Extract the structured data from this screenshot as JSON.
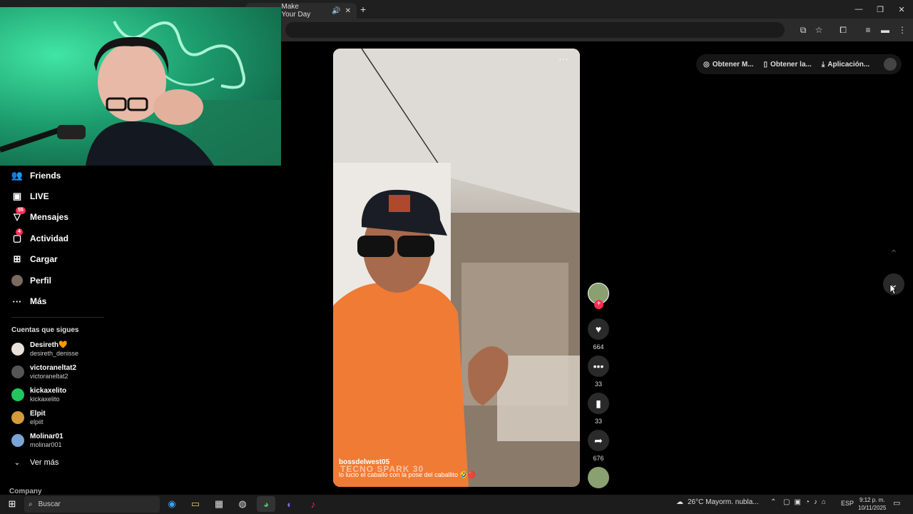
{
  "browser": {
    "active_tab_title": "Make Your Day",
    "new_tab_label": "+",
    "window_buttons": {
      "minimize": "—",
      "maximize": "❐",
      "close": "✕"
    }
  },
  "sidebar": {
    "items": [
      {
        "label": "Friends",
        "icon": "friends-icon",
        "glyph": "👥"
      },
      {
        "label": "LIVE",
        "icon": "live-icon",
        "glyph": "📺"
      },
      {
        "label": "Mensajes",
        "icon": "messages-icon",
        "glyph": "✈",
        "badge": "55"
      },
      {
        "label": "Actividad",
        "icon": "activity-icon",
        "glyph": "💬",
        "badge": "4"
      },
      {
        "label": "Cargar",
        "icon": "upload-icon",
        "glyph": "⊞"
      },
      {
        "label": "Perfil",
        "icon": "profile-avatar",
        "glyph": "●"
      },
      {
        "label": "Más",
        "icon": "more-icon",
        "glyph": "···"
      }
    ],
    "following_header": "Cuentas que sigues",
    "following": [
      {
        "name": "Desireth🧡",
        "handle": "desireth_denisse",
        "color": "#e8e1dc"
      },
      {
        "name": "victoraneltat2",
        "handle": "victoraneltat2",
        "color": "#555555"
      },
      {
        "name": "kickaxelito",
        "handle": "kickaxelito",
        "color": "#22c55e"
      },
      {
        "name": "Elpit",
        "handle": "elpiit",
        "color": "#d59a3a"
      },
      {
        "name": "Molinar01",
        "handle": "molinar001",
        "color": "#7aa4d6"
      }
    ],
    "see_more": "Ver más",
    "company": "Company"
  },
  "video": {
    "username": "bossdelwest05",
    "caption": "lo lucio el caballo con la pose del caballito 🤣🔴",
    "watermark": "TECNO SPARK 30",
    "more_glyph": "···"
  },
  "actions": {
    "likes": "664",
    "comments": "33",
    "saves": "33",
    "shares": "676"
  },
  "top_actions": {
    "btn1": "Obtener M...",
    "btn2": "Obtener la...",
    "btn3": "Aplicación..."
  },
  "taskbar": {
    "search_placeholder": "Buscar",
    "weather": "26°C  Mayorm. nubla...",
    "language": "ESP",
    "time": "9:12 p. m.",
    "date": "10/11/2025"
  },
  "colors": {
    "accent": "#fe2c55",
    "background": "#000000"
  }
}
